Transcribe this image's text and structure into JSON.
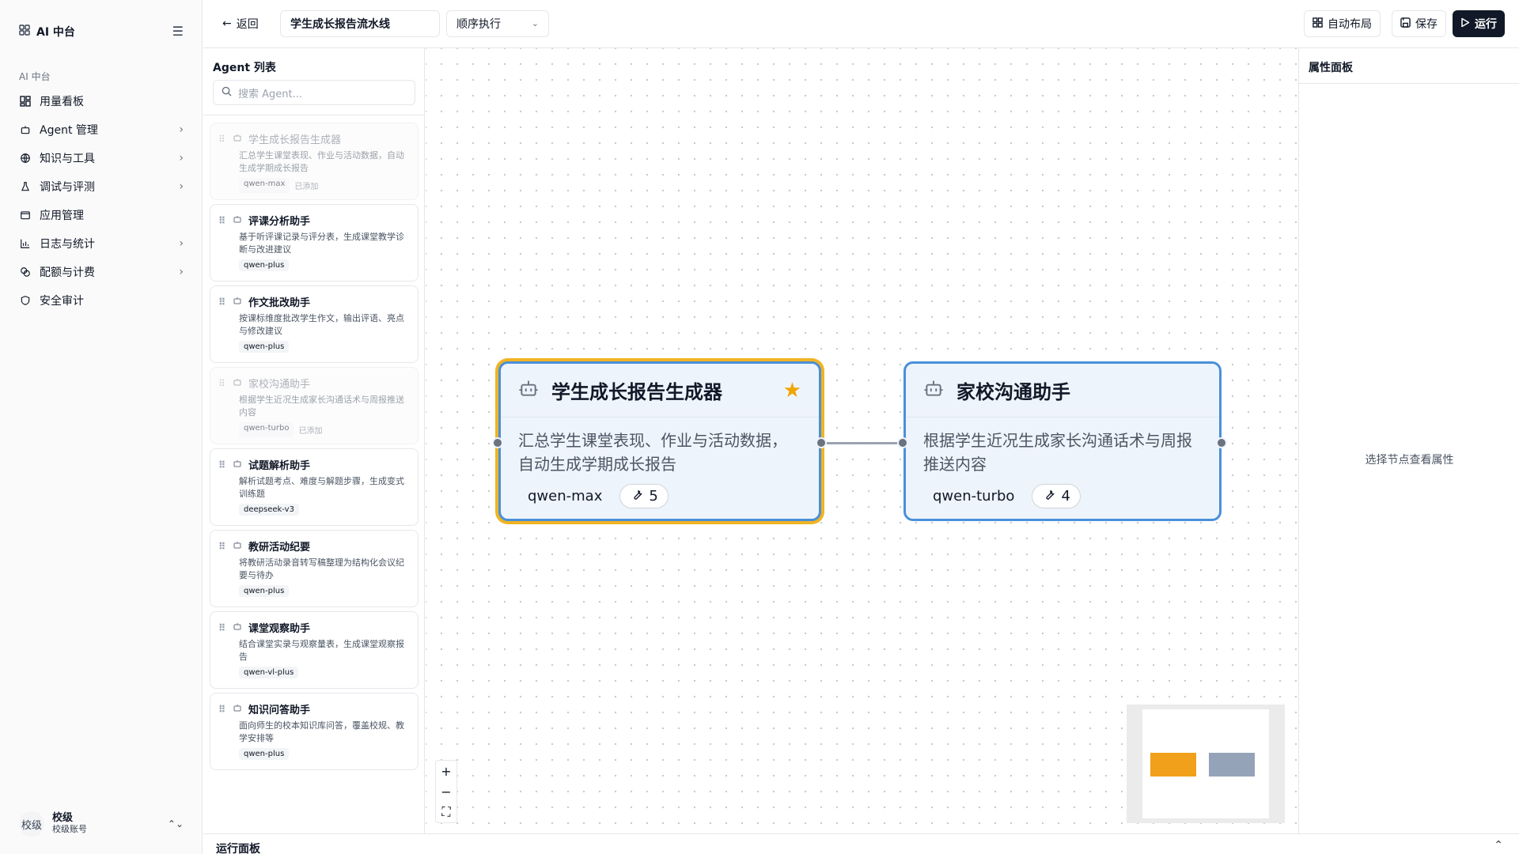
{
  "sidebar": {
    "app_title": "AI 中台",
    "group_label": "AI 中台",
    "items": [
      {
        "label": "用量看板",
        "icon": "dashboard-icon",
        "expandable": false
      },
      {
        "label": "Agent 管理",
        "icon": "bot-icon",
        "expandable": true
      },
      {
        "label": "知识与工具",
        "icon": "globe-icon",
        "expandable": true
      },
      {
        "label": "调试与评测",
        "icon": "flask-icon",
        "expandable": true
      },
      {
        "label": "应用管理",
        "icon": "app-window-icon",
        "expandable": false
      },
      {
        "label": "日志与统计",
        "icon": "bar-chart-icon",
        "expandable": true
      },
      {
        "label": "配额与计费",
        "icon": "coins-icon",
        "expandable": true
      },
      {
        "label": "安全审计",
        "icon": "shield-icon",
        "expandable": false
      }
    ],
    "user": {
      "avatar": "校级",
      "name": "校级",
      "role": "校级账号"
    }
  },
  "toolbar": {
    "back_label": "返回",
    "pipeline_name": "学生成长报告流水线",
    "mode_value": "顺序执行",
    "auto_layout_label": "自动布局",
    "save_label": "保存",
    "run_label": "运行"
  },
  "agent_panel": {
    "title": "Agent 列表",
    "search_placeholder": "搜索 Agent...",
    "added_label": "已添加",
    "agents": [
      {
        "name": "学生成长报告生成器",
        "desc": "汇总学生课堂表现、作业与活动数据，自动生成学期成长报告",
        "model": "qwen-max",
        "added": true
      },
      {
        "name": "评课分析助手",
        "desc": "基于听评课记录与评分表，生成课堂教学诊断与改进建议",
        "model": "qwen-plus",
        "added": false
      },
      {
        "name": "作文批改助手",
        "desc": "按课标维度批改学生作文，输出评语、亮点与修改建议",
        "model": "qwen-plus",
        "added": false
      },
      {
        "name": "家校沟通助手",
        "desc": "根据学生近况生成家长沟通话术与周报推送内容",
        "model": "qwen-turbo",
        "added": true
      },
      {
        "name": "试题解析助手",
        "desc": "解析试题考点、难度与解题步骤，生成变式训练题",
        "model": "deepseek-v3",
        "added": false
      },
      {
        "name": "教研活动纪要",
        "desc": "将教研活动录音转写稿整理为结构化会议纪要与待办",
        "model": "qwen-plus",
        "added": false
      },
      {
        "name": "课堂观察助手",
        "desc": "结合课堂实录与观察量表，生成课堂观察报告",
        "model": "qwen-vl-plus",
        "added": false
      },
      {
        "name": "知识问答助手",
        "desc": "面向师生的校本知识库问答，覆盖校规、教学安排等",
        "model": "qwen-plus",
        "added": false
      }
    ]
  },
  "canvas": {
    "nodes": [
      {
        "name": "学生成长报告生成器",
        "desc": "汇总学生课堂表现、作业与活动数据，自动生成学期成长报告",
        "model": "qwen-max",
        "tools": "5",
        "selected": true,
        "starred": true
      },
      {
        "name": "家校沟通助手",
        "desc": "根据学生近况生成家长沟通话术与周报推送内容",
        "model": "qwen-turbo",
        "tools": "4",
        "selected": false,
        "starred": false
      }
    ],
    "zoom_controls": {
      "in": "+",
      "out": "−",
      "fit": "⛶"
    },
    "colors": {
      "node_border": "#4a90d9",
      "node_fill": "#eef4fb",
      "selected_outline": "#f0b323",
      "minimap_selected": "#f0a01a",
      "minimap_node": "#94a3b8"
    }
  },
  "properties": {
    "title": "属性面板",
    "empty_text": "选择节点查看属性"
  },
  "run_panel": {
    "title": "运行面板"
  }
}
